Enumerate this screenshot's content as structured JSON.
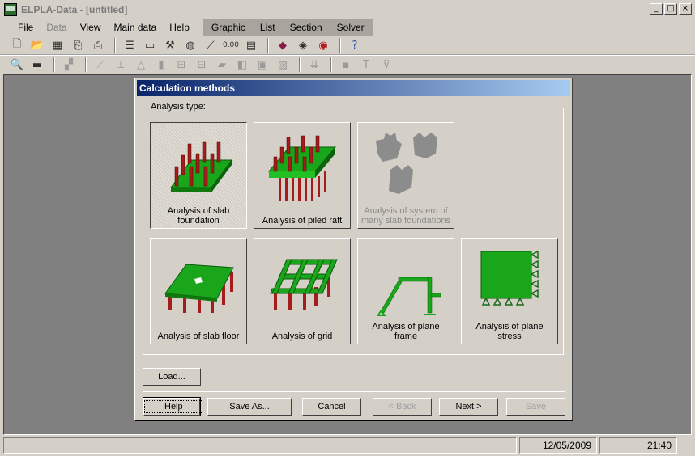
{
  "app": {
    "title": "ELPLA-Data - [untitled]",
    "window_buttons": [
      "_",
      "□",
      "×"
    ]
  },
  "menu": {
    "items": [
      {
        "label": "File",
        "disabled": false
      },
      {
        "label": "Data",
        "disabled": true
      },
      {
        "label": "View",
        "disabled": false
      },
      {
        "label": "Main data",
        "disabled": false
      },
      {
        "label": "Help",
        "disabled": false
      }
    ],
    "dark_items": [
      "Graphic",
      "List",
      "Section",
      "Solver"
    ]
  },
  "toolbar1": {
    "zero_label": "0.00"
  },
  "dialog": {
    "title": "Calculation methods",
    "group_label": "Analysis type:",
    "choices": [
      {
        "label": "Analysis of slab foundation",
        "icon": "slab-foundation-icon",
        "state": "selected"
      },
      {
        "label": "Analysis of piled raft",
        "icon": "piled-raft-icon",
        "state": "normal"
      },
      {
        "label": "Analysis of system of many slab foundations",
        "icon": "system-slab-foundations-icon",
        "state": "disabled"
      },
      {
        "label": "Analysis of slab floor",
        "icon": "slab-floor-icon",
        "state": "normal"
      },
      {
        "label": "Analysis of grid",
        "icon": "grid-icon",
        "state": "normal"
      },
      {
        "label": "Analysis of plane frame",
        "icon": "plane-frame-icon",
        "state": "normal"
      },
      {
        "label": "Analysis of plane stress",
        "icon": "plane-stress-icon",
        "state": "normal"
      }
    ],
    "load_button": "Load...",
    "buttons": {
      "help": "Help",
      "save_as": "Save As...",
      "cancel": "Cancel",
      "back": "< Back",
      "next": "Next >",
      "save": "Save"
    }
  },
  "status": {
    "date": "12/05/2009",
    "time": "21:40"
  },
  "colors": {
    "structure_green": "#1aa61a",
    "pile_red": "#a41c1c",
    "title_gradient_start": "#0a246a",
    "title_gradient_end": "#a6caf0",
    "workspace": "#808080"
  }
}
